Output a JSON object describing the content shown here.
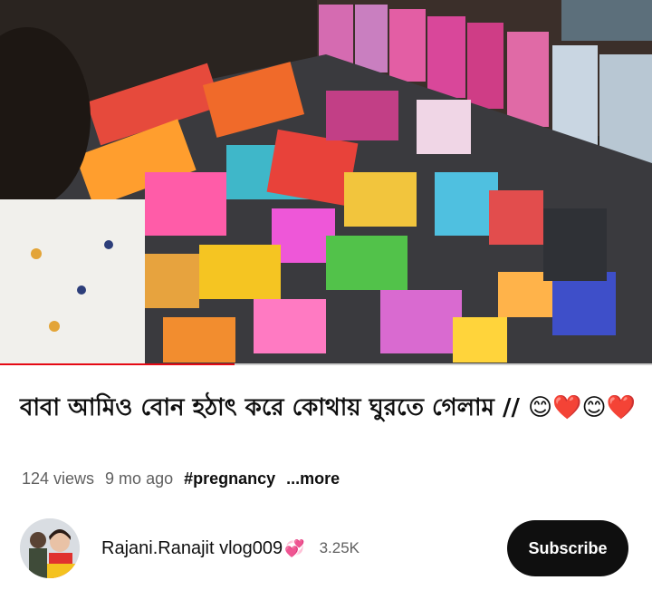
{
  "video": {
    "progress_fraction": 0.36
  },
  "title": "বাবা আমিও বোন হঠাৎ করে কোথায় ঘুরতে গেলাম // 😊❤️😊❤️",
  "meta": {
    "views": "124 views",
    "age": "9 mo ago",
    "hashtag": "#pregnancy",
    "more": "...more"
  },
  "channel": {
    "name": "Rajani.Ranajit vlog009",
    "heart_emoji": "💞",
    "subscribers": "3.25K",
    "subscribe_label": "Subscribe"
  },
  "colors": {
    "progress": "#e50914",
    "subscribe_bg": "#0f0f0f"
  }
}
